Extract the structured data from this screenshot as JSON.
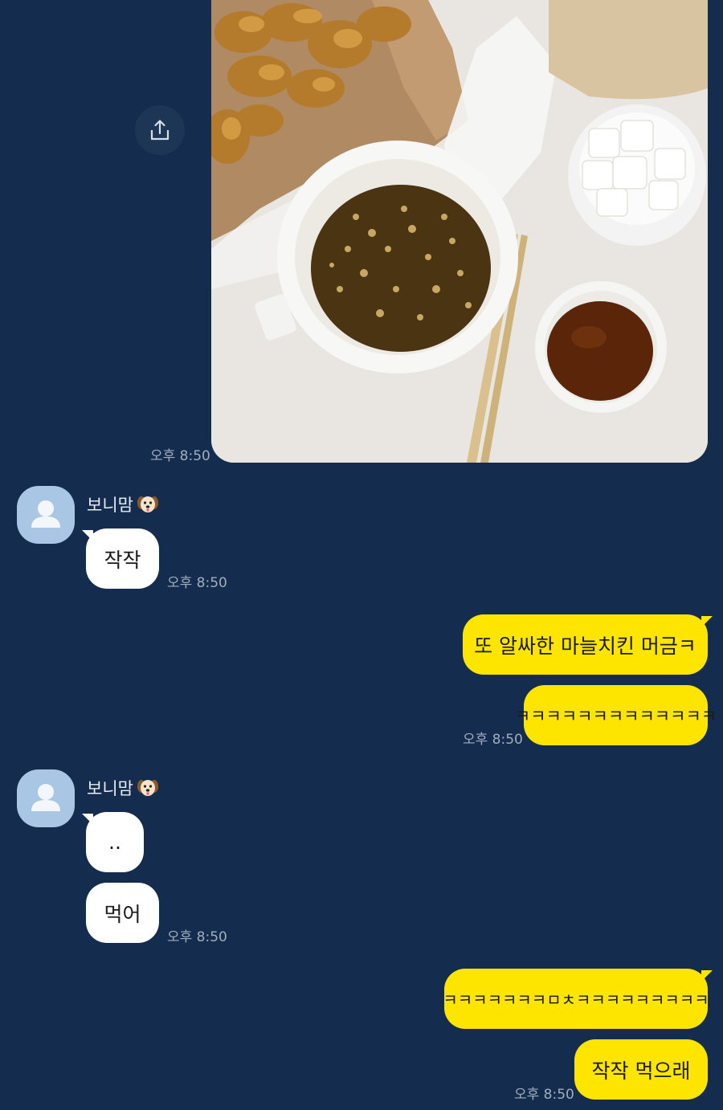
{
  "chat": {
    "photo_message": {
      "time": "오후 8:50",
      "share_icon": "share-upload-icon"
    },
    "group1": {
      "sender": "보니맘",
      "sender_emoji": "dog-face-emoji",
      "messages": [
        "작작"
      ],
      "time": "오후 8:50"
    },
    "group2": {
      "messages": [
        "또 알싸한 마늘치킨 머금ㅋ",
        "ㅋㅋㅋㅋㅋㅋㅋㅋㅋㅋㅋㅋㅋ"
      ],
      "time": "오후 8:50"
    },
    "group3": {
      "sender": "보니맘",
      "sender_emoji": "dog-face-emoji",
      "messages": [
        "..",
        "먹어"
      ],
      "time": "오후 8:50"
    },
    "group4": {
      "messages": [
        "ㅋㅋㅋㅋㅋㅋㅋㅁㅊㅋㅋㅋㅋㅋㅋㅋㅋㅋ",
        "작작 먹으래"
      ],
      "time": "오후 8:50"
    }
  },
  "colors": {
    "background": "#142d4f",
    "bubble_incoming": "#ffffff",
    "bubble_outgoing": "#fee500",
    "timestamp": "#a2adbd",
    "avatar": "#a9c6e5"
  }
}
